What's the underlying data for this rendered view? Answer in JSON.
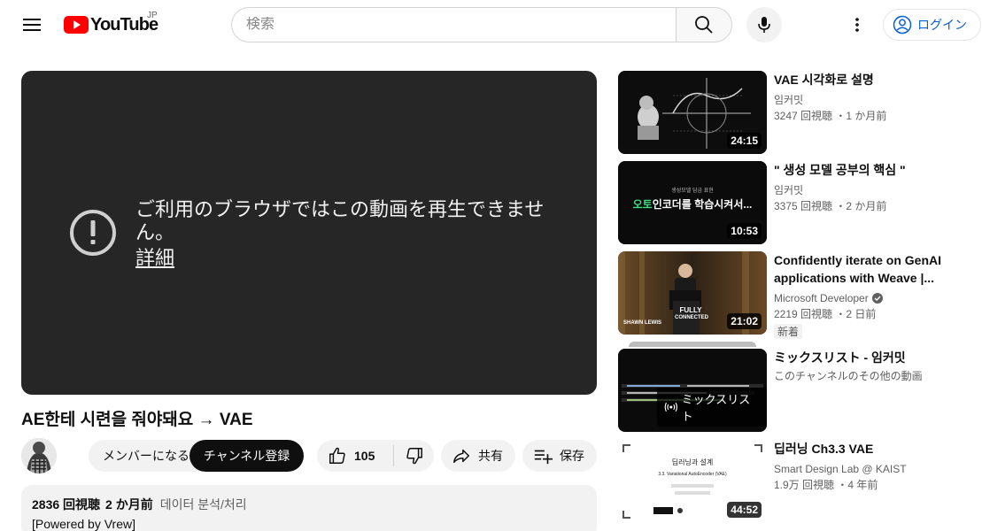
{
  "header": {
    "logo_text": "YouTube",
    "country_code": "JP",
    "search_placeholder": "検索",
    "login_label": "ログイン"
  },
  "player": {
    "error_message": "ご利用のブラウザではこの動画を再生できません。",
    "detail_link": "詳細"
  },
  "video": {
    "title": "AE한테 시련을 줘야돼요 → VAE",
    "member_label": "メンバーになる",
    "subscribe_label": "チャンネル登録",
    "like_count": "105",
    "share_label": "共有",
    "save_label": "保存",
    "description": {
      "views": "2836 回視聴",
      "date": "2 か月前",
      "tag": "데이터 분석/처리",
      "text": "[Powered by Vrew]"
    }
  },
  "recommendations": [
    {
      "title": "VAE 시각화로 설명",
      "channel": "임커밋",
      "meta": "3247 回視聴 ・1 か月前",
      "duration": "24:15"
    },
    {
      "title": "\" 생성 모델 공부의 핵심 \"",
      "channel": "임커밋",
      "meta": "3375 回視聴 ・2 か月前",
      "duration": "10:53",
      "thumb_small": "생성모델 담금 표현",
      "thumb_highlight": "오토",
      "thumb_text": "인코더를 학습시켜서..."
    },
    {
      "title": "Confidently iterate on GenAI applications with Weave |...",
      "channel": "Microsoft Developer",
      "meta": "2219 回視聴 ・2 日前",
      "badge": "新着",
      "duration": "21:02",
      "thumb_presenter": "SHAWN LEWIS",
      "thumb_event_line1": "FULLY",
      "thumb_event_line2": "CONNECTED"
    },
    {
      "title": "ミックスリスト - 임커밋",
      "channel": "このチャンネルのその他の動画",
      "mix_label": "ミックスリスト"
    },
    {
      "title": "딥러닝 Ch3.3 VAE",
      "channel": "Smart Design Lab @ KAIST",
      "meta": "1.9万 回視聴 ・4 年前",
      "duration": "44:52",
      "thumb_title": "딥러닝과 설계",
      "thumb_subtitle": "3.3. Variational AutoEncoder (VAE)"
    }
  ],
  "colors": {
    "brand_red": "#ff0000",
    "link_blue": "#065fd4",
    "player_bg": "#262626"
  }
}
